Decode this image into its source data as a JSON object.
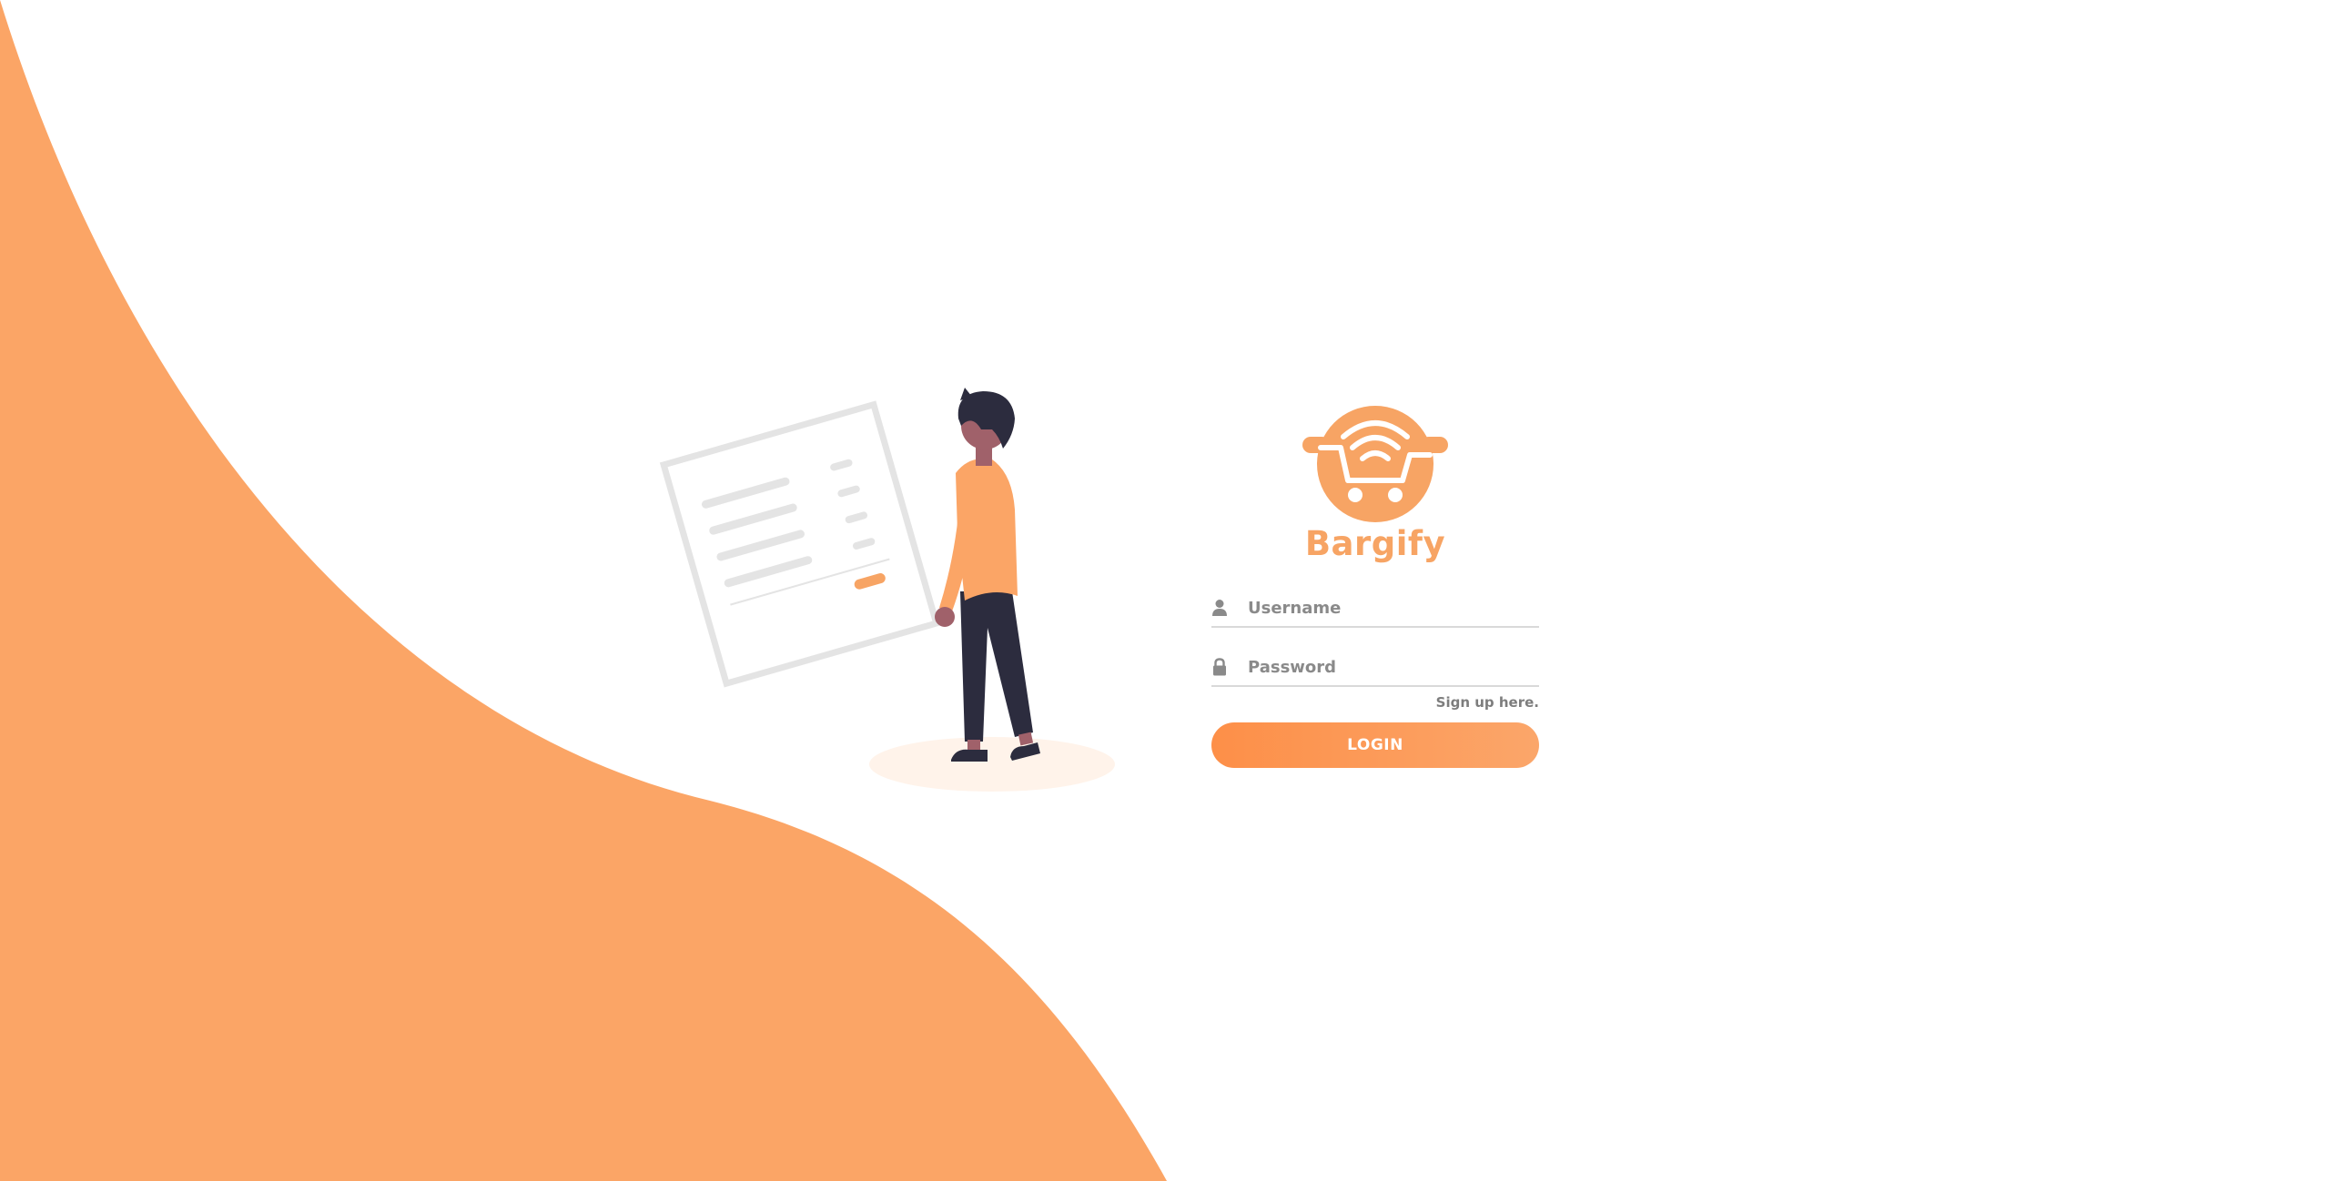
{
  "brand": {
    "name": "Bargify",
    "color": "#f7a464"
  },
  "background": {
    "wave_color": "#fba566"
  },
  "form": {
    "username_placeholder": "Username",
    "username_value": "",
    "password_placeholder": "Password",
    "password_value": "",
    "signup_label": "Sign up here.",
    "login_label": "LOGIN"
  },
  "icons": {
    "username": "user-icon",
    "password": "lock-icon",
    "logo": "shopping-cart-wifi-icon"
  }
}
